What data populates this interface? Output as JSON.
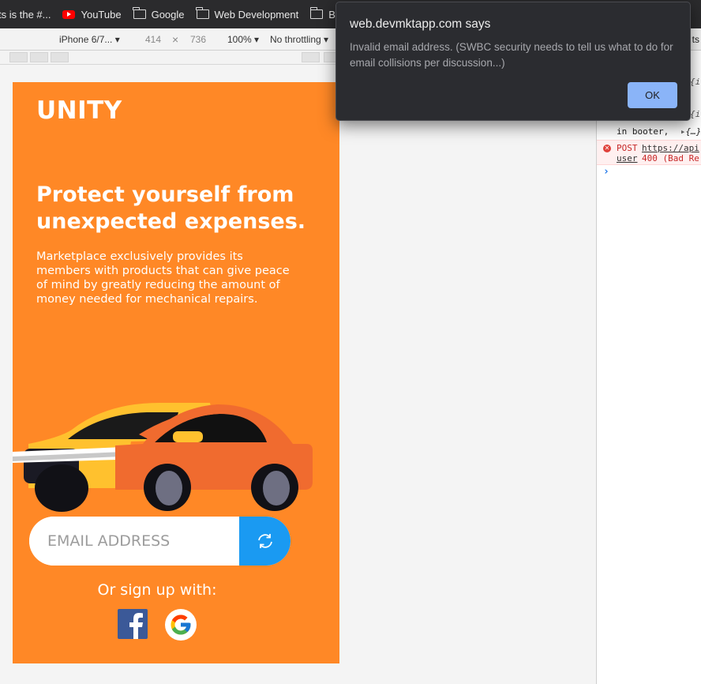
{
  "bookmarks": [
    {
      "label": "ts is the #...",
      "icon": "none"
    },
    {
      "label": "YouTube",
      "icon": "youtube-icon"
    },
    {
      "label": "Google",
      "icon": "folder-icon"
    },
    {
      "label": "Web Development",
      "icon": "folder-icon"
    },
    {
      "label": "B",
      "icon": "folder-icon"
    }
  ],
  "device_toolbar": {
    "device": "iPhone 6/7...",
    "width": "414",
    "times": "×",
    "height": "736",
    "zoom": "100%",
    "throttle": "No throttling"
  },
  "devtools": {
    "tab_fragment": "ts",
    "lines": {
      "l1": "{i",
      "l2": "{i",
      "booter": "in booter,",
      "booter_obj": "{…}",
      "post": "POST",
      "post_url": "https://api",
      "user": "user",
      "status": "400 (Bad Re",
      "prompt": "›"
    }
  },
  "page": {
    "logo": "UNITY",
    "headline": "Protect yourself from unexpected expenses.",
    "description": "Marketplace exclusively provides its members with products that can give peace of mind by greatly reducing the amount of money needed for mechanical repairs.",
    "email_placeholder": "EMAIL ADDRESS",
    "signup_text": "Or sign up with:",
    "colors": {
      "background": "#ff8826",
      "button": "#1a9af2",
      "facebook": "#3b5998"
    }
  },
  "dialog": {
    "title": "web.devmktapp.com says",
    "message": "Invalid email address. (SWBC security needs to tell us what to do for email collisions per discussion...)",
    "ok_label": "OK"
  }
}
